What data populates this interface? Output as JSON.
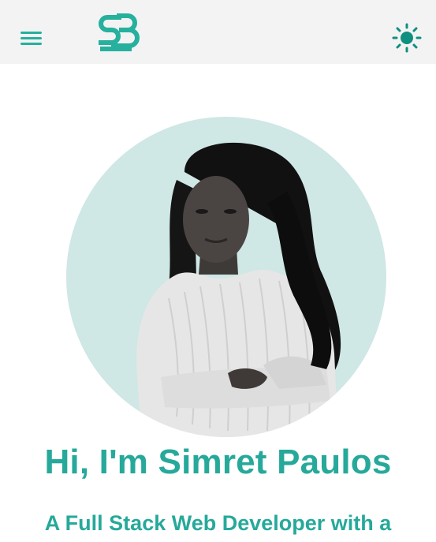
{
  "header": {
    "menu_icon": "hamburger-menu-icon",
    "logo_icon": "sb-monogram-logo",
    "theme_icon": "sun-icon"
  },
  "hero": {
    "avatar_alt": "portrait-photo",
    "title": "Hi, I'm Simret Paulos",
    "subtitle": "A Full Stack Web Developer with a"
  },
  "colors": {
    "accent": "#26a99a",
    "header_bg": "#f3f3f3",
    "avatar_bg": "#cfe7e5",
    "theme_icon": "#0f8f80"
  }
}
